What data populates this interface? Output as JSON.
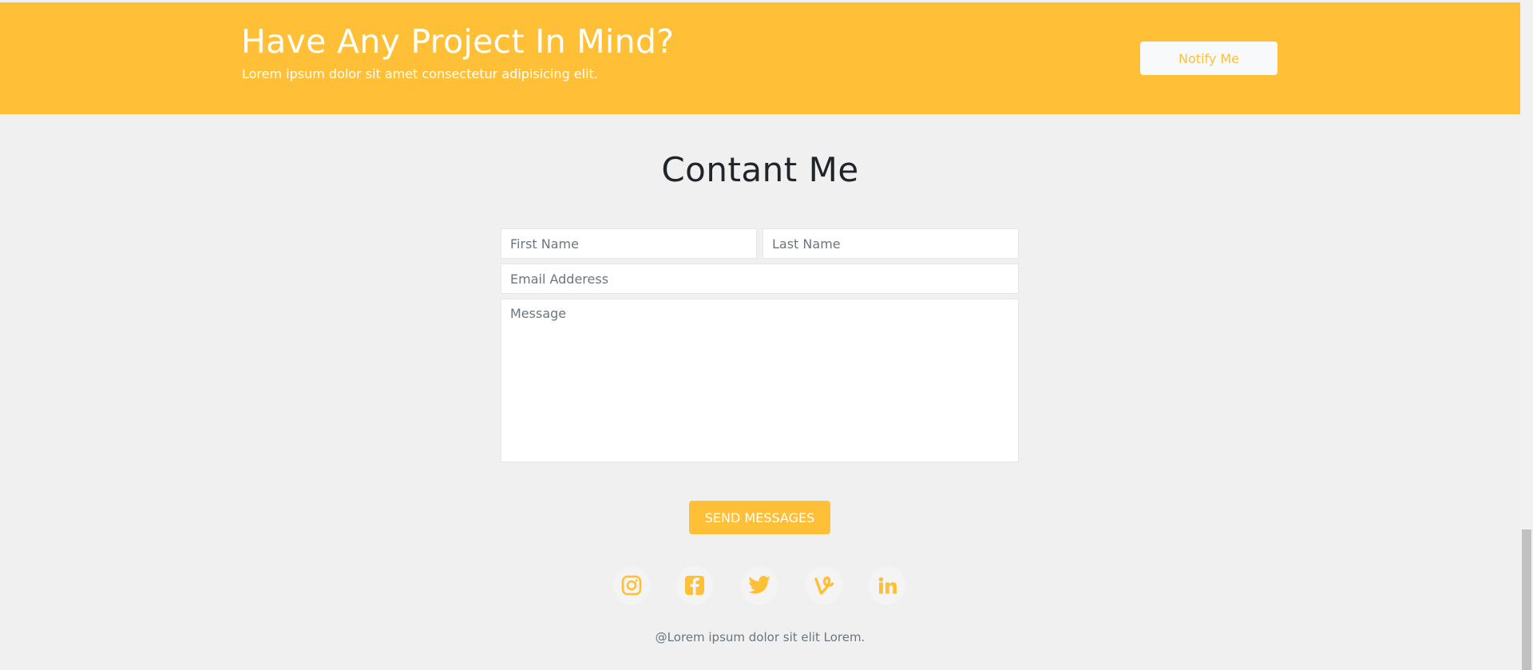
{
  "banner": {
    "title": "Have Any Project In Mind?",
    "subtitle": "Lorem ipsum dolor sit amet consectetur adipisicing elit.",
    "notify_label": "Notify Me"
  },
  "contact": {
    "title": "Contant Me",
    "first_name_placeholder": "First Name",
    "last_name_placeholder": "Last Name",
    "email_placeholder": "Email Adderess",
    "message_placeholder": "Message",
    "send_label": "SEND MESSAGES"
  },
  "social": [
    {
      "icon": "instagram-icon"
    },
    {
      "icon": "facebook-icon"
    },
    {
      "icon": "twitter-icon"
    },
    {
      "icon": "vine-icon"
    },
    {
      "icon": "linkedin-icon"
    }
  ],
  "footer": {
    "text": "@Lorem ipsum dolor sit elit Lorem."
  },
  "colors": {
    "accent": "#ffc038",
    "background": "#f0f0f0",
    "heading": "#212529"
  }
}
